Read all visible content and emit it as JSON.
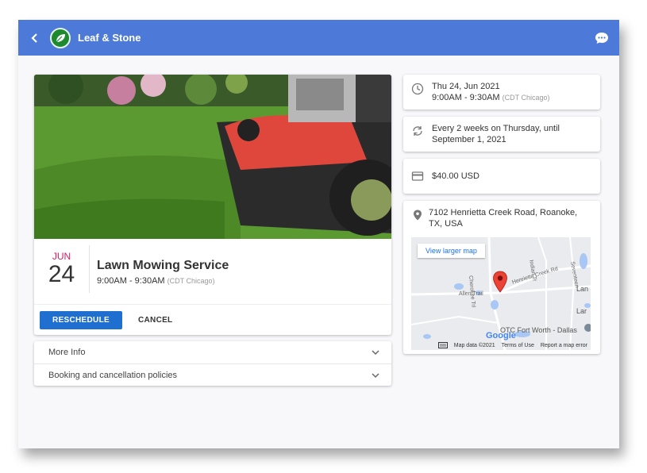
{
  "app": {
    "brand": "Leaf & Stone"
  },
  "service": {
    "month": "JUN",
    "day": "24",
    "title": "Lawn Mowing Service",
    "time": "9:00AM - 9:30AM",
    "tz": "(CDT Chicago)"
  },
  "actions": {
    "reschedule": "RESCHEDULE",
    "cancel": "CANCEL"
  },
  "accordion": [
    {
      "label": "More Info"
    },
    {
      "label": "Booking and cancellation policies"
    }
  ],
  "details": {
    "date_line": "Thu 24, Jun 2021",
    "time_line": "9:00AM - 9:30AM",
    "tz": "(CDT Chicago)",
    "recurrence": "Every 2 weeks on Thursday, until September 1, 2021",
    "price": "$40.00 USD",
    "address": "7102 Henrietta Creek Road, Roanoke, TX, USA"
  },
  "map": {
    "larger_link": "View larger map",
    "labels": {
      "road1": "Henrietta Creek Rd",
      "road2": "Allen Trail",
      "road3": "Cherokee Trl",
      "place1": "Lan",
      "place2": "Lar",
      "place3": "OTC Fort Worth - Dallas",
      "road4": "Indian Tr",
      "road5": "Seventeen"
    },
    "google": "Google",
    "footer": {
      "data": "Map data ©2021",
      "terms": "Terms of Use",
      "report": "Report a map error"
    }
  },
  "colors": {
    "appbar": "#4d79d8",
    "primary": "#1e6fd0",
    "accent_month": "#d81b60",
    "brand_green": "#1e8a2f"
  }
}
